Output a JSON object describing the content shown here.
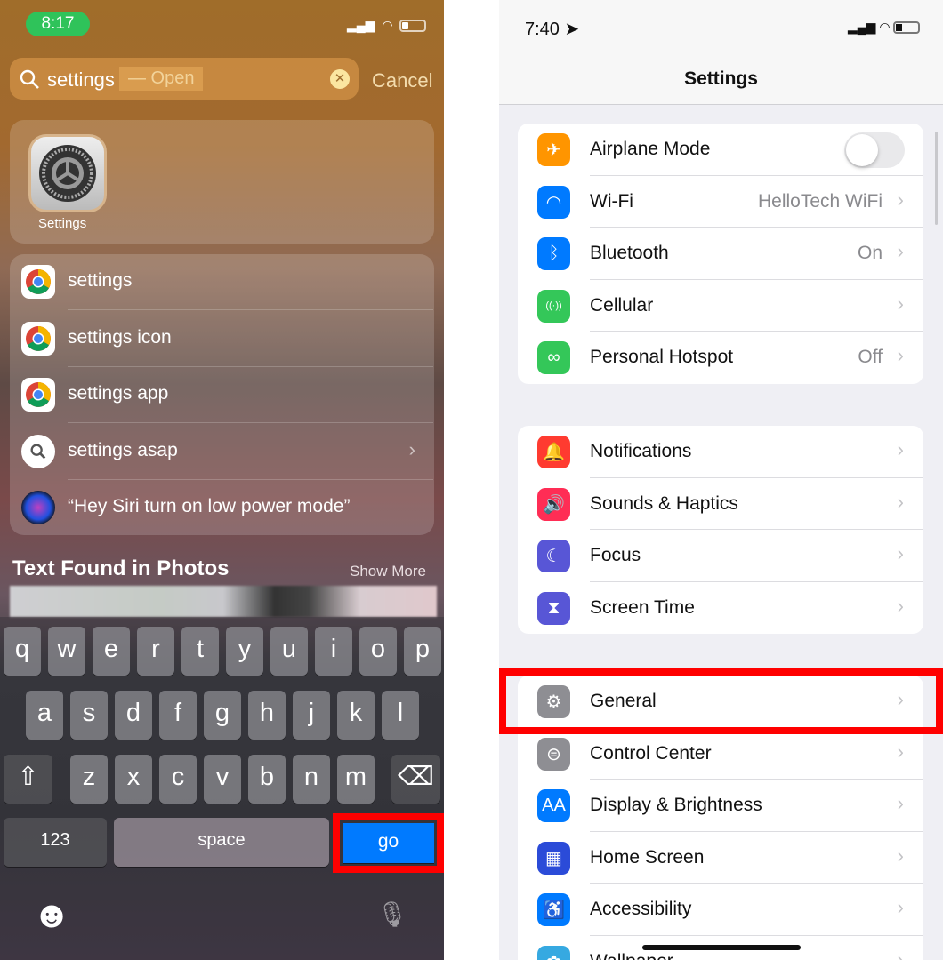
{
  "left": {
    "time": "8:17",
    "search": {
      "query": "settings",
      "suggestion": "— Open",
      "cancel": "Cancel"
    },
    "top_hit": {
      "label": "Settings"
    },
    "suggestions": [
      {
        "text": "settings",
        "icon": "chrome-icon"
      },
      {
        "text": "settings icon",
        "icon": "chrome-icon"
      },
      {
        "text": "settings app",
        "icon": "chrome-icon"
      },
      {
        "text": "settings asap",
        "icon": "search-icon",
        "chevron": true
      },
      {
        "text": "“Hey Siri turn on low power mode”",
        "icon": "siri-icon"
      }
    ],
    "photos_section": {
      "title": "Text Found in Photos",
      "show_more": "Show More"
    },
    "keyboard": {
      "row1": [
        "q",
        "w",
        "e",
        "r",
        "t",
        "y",
        "u",
        "i",
        "o",
        "p"
      ],
      "row2": [
        "a",
        "s",
        "d",
        "f",
        "g",
        "h",
        "j",
        "k",
        "l"
      ],
      "row3": [
        "z",
        "x",
        "c",
        "v",
        "b",
        "n",
        "m"
      ],
      "numbers": "123",
      "space": "space",
      "go": "go"
    }
  },
  "right": {
    "time": "7:40",
    "title": "Settings",
    "groups": [
      [
        {
          "label": "Airplane Mode",
          "color": "#ff9500",
          "icon": "airplane-icon",
          "toggle": false
        },
        {
          "label": "Wi-Fi",
          "value": "HelloTech WiFi",
          "color": "#007aff",
          "icon": "wifi-icon"
        },
        {
          "label": "Bluetooth",
          "value": "On",
          "color": "#007aff",
          "icon": "bluetooth-icon"
        },
        {
          "label": "Cellular",
          "color": "#34c759",
          "icon": "cellular-icon"
        },
        {
          "label": "Personal Hotspot",
          "value": "Off",
          "color": "#34c759",
          "icon": "hotspot-icon"
        }
      ],
      [
        {
          "label": "Notifications",
          "color": "#ff3b30",
          "icon": "bell-icon"
        },
        {
          "label": "Sounds & Haptics",
          "color": "#ff2d55",
          "icon": "speaker-icon"
        },
        {
          "label": "Focus",
          "color": "#5856d6",
          "icon": "moon-icon"
        },
        {
          "label": "Screen Time",
          "color": "#5856d6",
          "icon": "hourglass-icon"
        }
      ],
      [
        {
          "label": "General",
          "color": "#8e8e93",
          "icon": "gear-icon"
        },
        {
          "label": "Control Center",
          "color": "#8e8e93",
          "icon": "switches-icon"
        },
        {
          "label": "Display & Brightness",
          "color": "#007aff",
          "icon": "text-size-icon",
          "glyph": "AA"
        },
        {
          "label": "Home Screen",
          "color": "#2b4bd8",
          "icon": "home-grid-icon"
        },
        {
          "label": "Accessibility",
          "color": "#007aff",
          "icon": "accessibility-icon"
        },
        {
          "label": "Wallpaper",
          "color": "#36a9e1",
          "icon": "wallpaper-icon"
        }
      ]
    ]
  }
}
